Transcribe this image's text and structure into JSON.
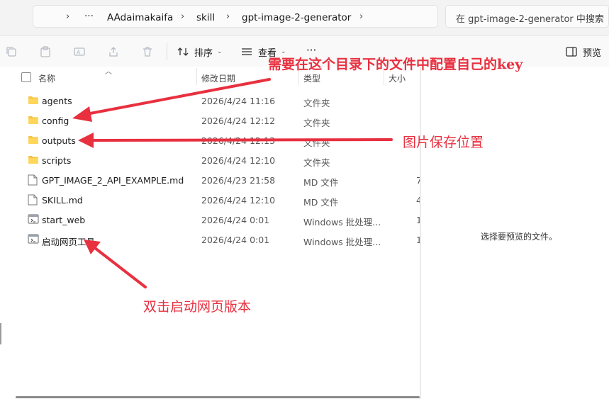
{
  "address_bar": {
    "crumbs": [
      "AAdaimakaifa",
      "skill",
      "gpt-image-2-generator"
    ],
    "more": "···",
    "search_placeholder": "在 gpt-image-2-generator 中搜索"
  },
  "toolbar": {
    "sort_label": "排序",
    "view_label": "查看",
    "more_label": "···",
    "preview_label": "预览"
  },
  "columns": {
    "name": "名称",
    "date": "修改日期",
    "type": "类型",
    "size": "大小"
  },
  "files": [
    {
      "name": "agents",
      "date": "2026/4/24 11:16",
      "type": "文件夹",
      "size": "",
      "icon": "folder-icon"
    },
    {
      "name": "config",
      "date": "2026/4/24 12:12",
      "type": "文件夹",
      "size": "",
      "icon": "folder-icon"
    },
    {
      "name": "outputs",
      "date": "2026/4/24 12:13",
      "type": "文件夹",
      "size": "",
      "icon": "folder-icon"
    },
    {
      "name": "scripts",
      "date": "2026/4/24 12:10",
      "type": "文件夹",
      "size": "",
      "icon": "folder-icon"
    },
    {
      "name": "GPT_IMAGE_2_API_EXAMPLE.md",
      "date": "2026/4/23 21:58",
      "type": "MD 文件",
      "size": "7",
      "icon": "file-icon"
    },
    {
      "name": "SKILL.md",
      "date": "2026/4/24 12:10",
      "type": "MD 文件",
      "size": "4",
      "icon": "file-icon"
    },
    {
      "name": "start_web",
      "date": "2026/4/24 0:01",
      "type": "Windows 批处理...",
      "size": "1",
      "icon": "batch-file-icon"
    },
    {
      "name": "启动网页工具",
      "date": "2026/4/24 0:01",
      "type": "Windows 批处理...",
      "size": "1",
      "icon": "batch-file-icon"
    }
  ],
  "preview": {
    "empty_text": "选择要预览的文件。"
  },
  "annotations": {
    "config_note": "需要在这个目录下的文件中配置自己的key",
    "outputs_note": "图片保存位置",
    "launch_note": "双击启动网页版本",
    "color": "#e8303f"
  }
}
